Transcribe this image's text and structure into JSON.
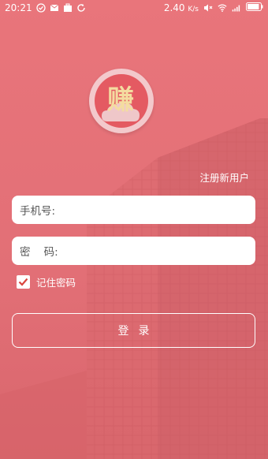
{
  "status_bar": {
    "time": "20:21",
    "network_speed": "2.40",
    "network_speed_unit": "K/s",
    "battery_level": 0.9
  },
  "logo": {
    "glyph": "赚"
  },
  "register_link": "注册新用户",
  "form": {
    "phone_label": "手机号:",
    "phone_value": "",
    "password_label": "密    码:",
    "password_value": "",
    "remember_label": "记住密码",
    "remember_checked": true,
    "login_label": "登录"
  },
  "colors": {
    "background": "#e5747a",
    "accent": "#e45a62",
    "check": "#d9453e"
  }
}
